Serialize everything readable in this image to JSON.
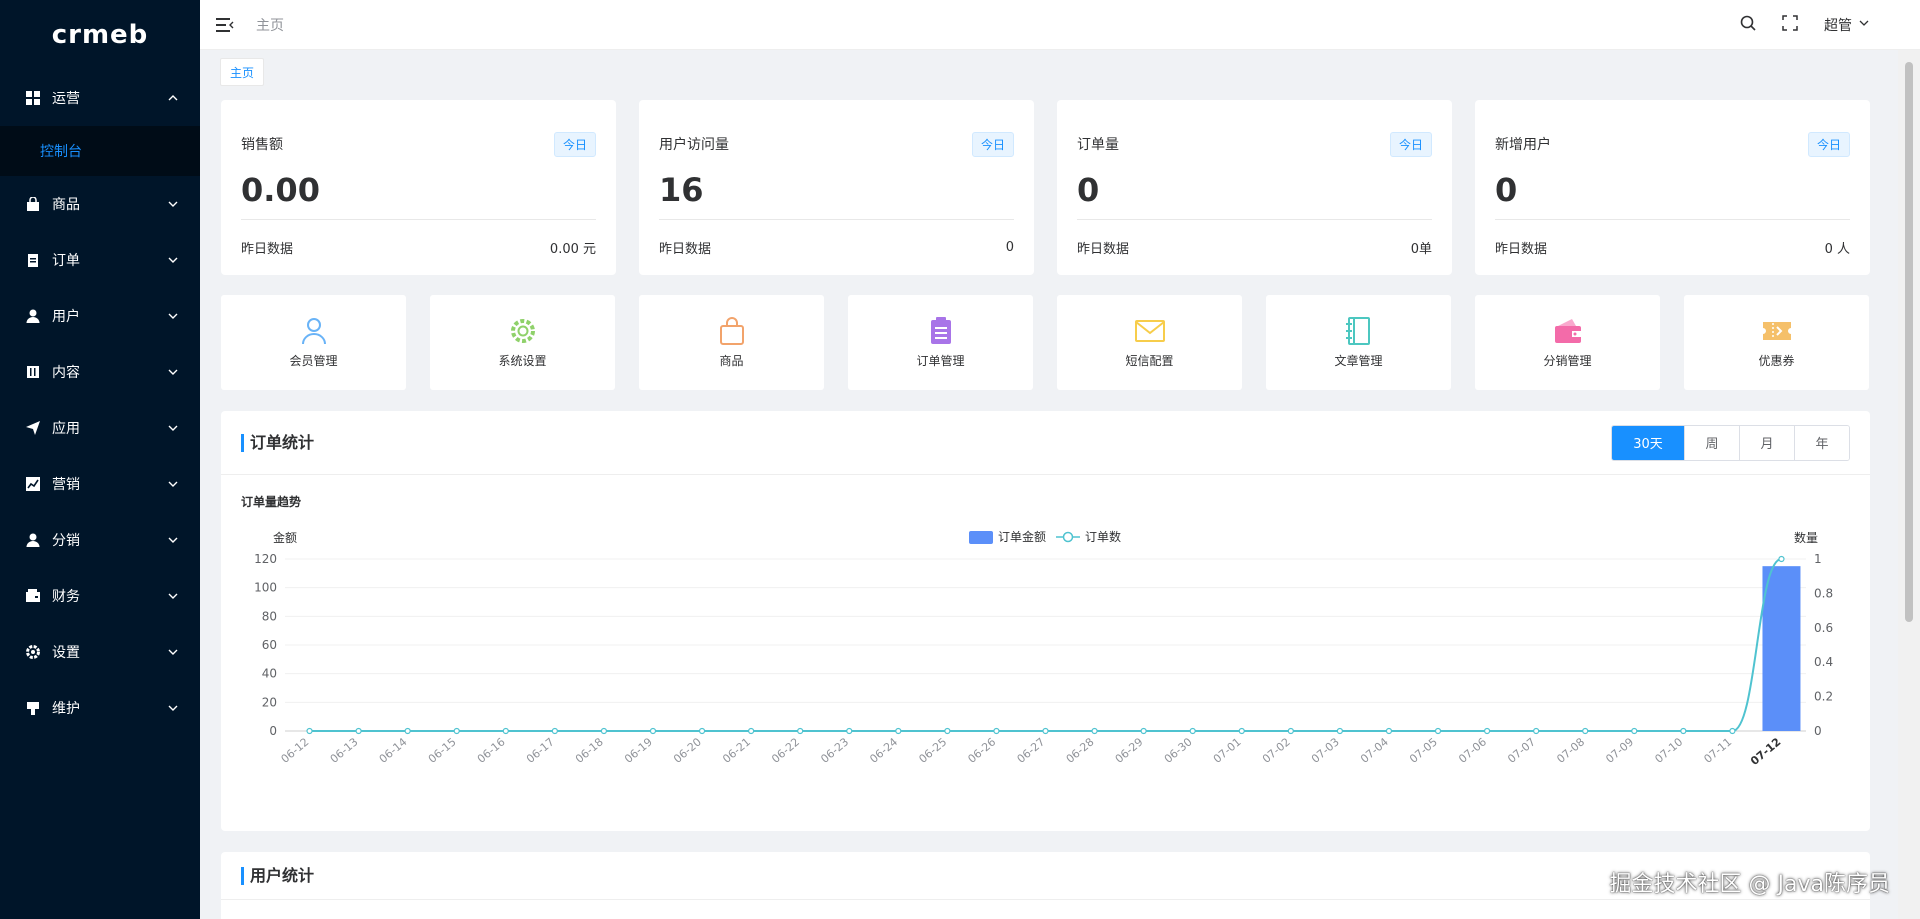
{
  "app": {
    "logo_text": "crmeb"
  },
  "sidebar": {
    "items": [
      {
        "label": "运营",
        "icon": "grid-icon",
        "expanded": true
      },
      {
        "label": "商品",
        "icon": "bag-icon"
      },
      {
        "label": "订单",
        "icon": "clipboard-icon"
      },
      {
        "label": "用户",
        "icon": "user-icon"
      },
      {
        "label": "内容",
        "icon": "content-icon"
      },
      {
        "label": "应用",
        "icon": "paper-plane-icon"
      },
      {
        "label": "营销",
        "icon": "chart-icon"
      },
      {
        "label": "分销",
        "icon": "user-icon"
      },
      {
        "label": "财务",
        "icon": "wallet-icon"
      },
      {
        "label": "设置",
        "icon": "gear-icon"
      },
      {
        "label": "维护",
        "icon": "tools-icon"
      }
    ],
    "sub_active": "控制台"
  },
  "header": {
    "breadcrumb": "主页",
    "user": "超管"
  },
  "tags": {
    "home": "主页"
  },
  "stats": [
    {
      "title": "销售额",
      "badge": "今日",
      "value": "0.00",
      "footer_label": "昨日数据",
      "footer_value": "0.00 元"
    },
    {
      "title": "用户访问量",
      "badge": "今日",
      "value": "16",
      "footer_label": "昨日数据",
      "footer_value": "0"
    },
    {
      "title": "订单量",
      "badge": "今日",
      "value": "0",
      "footer_label": "昨日数据",
      "footer_value": "0单"
    },
    {
      "title": "新增用户",
      "badge": "今日",
      "value": "0",
      "footer_label": "昨日数据",
      "footer_value": "0 人"
    }
  ],
  "quick_nav": [
    {
      "label": "会员管理",
      "icon": "member-icon",
      "color": "#69b3f7"
    },
    {
      "label": "系统设置",
      "icon": "gear-icon",
      "color": "#8fd16a"
    },
    {
      "label": "商品",
      "icon": "bag-icon",
      "color": "#f2a36b"
    },
    {
      "label": "订单管理",
      "icon": "clipboard-icon",
      "color": "#a874e8"
    },
    {
      "label": "短信配置",
      "icon": "mail-icon",
      "color": "#f7cd4b"
    },
    {
      "label": "文章管理",
      "icon": "notebook-icon",
      "color": "#4cc7c0"
    },
    {
      "label": "分销管理",
      "icon": "wallet-icon",
      "color": "#f36ba9"
    },
    {
      "label": "优惠券",
      "icon": "ticket-icon",
      "color": "#f5c06a"
    }
  ],
  "order_panel": {
    "title": "订单统计",
    "ranges": [
      "30天",
      "周",
      "月",
      "年"
    ],
    "active_range": "30天",
    "chart_subtitle": "订单量趋势"
  },
  "user_panel": {
    "title": "用户统计"
  },
  "watermark": "掘金技术社区 @ Java陈序员",
  "chart_data": {
    "type": "bar",
    "categories": [
      "06-12",
      "06-13",
      "06-14",
      "06-15",
      "06-16",
      "06-17",
      "06-18",
      "06-19",
      "06-20",
      "06-21",
      "06-22",
      "06-23",
      "06-24",
      "06-25",
      "06-26",
      "06-27",
      "06-28",
      "06-29",
      "06-30",
      "07-01",
      "07-02",
      "07-03",
      "07-04",
      "07-05",
      "07-06",
      "07-07",
      "07-08",
      "07-09",
      "07-10",
      "07-11",
      "07-12"
    ],
    "series": [
      {
        "name": "订单金额",
        "type": "bar",
        "axis": "left",
        "color": "#5b8ff9",
        "values": [
          0,
          0,
          0,
          0,
          0,
          0,
          0,
          0,
          0,
          0,
          0,
          0,
          0,
          0,
          0,
          0,
          0,
          0,
          0,
          0,
          0,
          0,
          0,
          0,
          0,
          0,
          0,
          0,
          0,
          0,
          115
        ]
      },
      {
        "name": "订单数",
        "type": "line",
        "axis": "right",
        "color": "#4fc3d0",
        "values": [
          0,
          0,
          0,
          0,
          0,
          0,
          0,
          0,
          0,
          0,
          0,
          0,
          0,
          0,
          0,
          0,
          0,
          0,
          0,
          0,
          0,
          0,
          0,
          0,
          0,
          0,
          0,
          0,
          0,
          0,
          1
        ]
      }
    ],
    "ylabel_left": "金额",
    "ylabel_right": "数量",
    "ylim_left": [
      0,
      120
    ],
    "yticks_left": [
      0,
      20,
      40,
      60,
      80,
      100,
      120
    ],
    "ylim_right": [
      0,
      1
    ],
    "yticks_right": [
      0,
      0.2,
      0.4,
      0.6,
      0.8,
      1
    ],
    "legend_position": "top-center",
    "grid": true
  }
}
